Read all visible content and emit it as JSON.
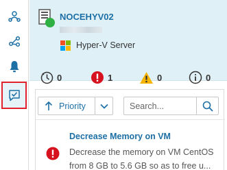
{
  "sidebar": {
    "items": [
      {
        "icon": "topology-icon",
        "active": false
      },
      {
        "icon": "connections-icon",
        "active": false
      },
      {
        "icon": "alerts-bell-icon",
        "active": false
      },
      {
        "icon": "recommendations-icon",
        "active": true
      }
    ]
  },
  "server": {
    "hostname": "NOCEHYV02",
    "status_color": "#2eb043",
    "type": "Hyper-V Server"
  },
  "counts": {
    "pending": "0",
    "critical": "1",
    "warning": "0",
    "info": "0"
  },
  "toolbar": {
    "priority_label": "Priority",
    "search_placeholder": "Search..."
  },
  "recommendations": [
    {
      "title": "Decrease Memory on VM",
      "description": "Decrease the memory on VM CentOS from 8 GB to 5.6 GB so as to free u...",
      "severity": "critical"
    }
  ],
  "colors": {
    "accent": "#1d6fa5",
    "header_bg": "#dff0f7",
    "critical": "#d6121f",
    "warning": "#f5b400",
    "active_outline": "#e0202b"
  }
}
